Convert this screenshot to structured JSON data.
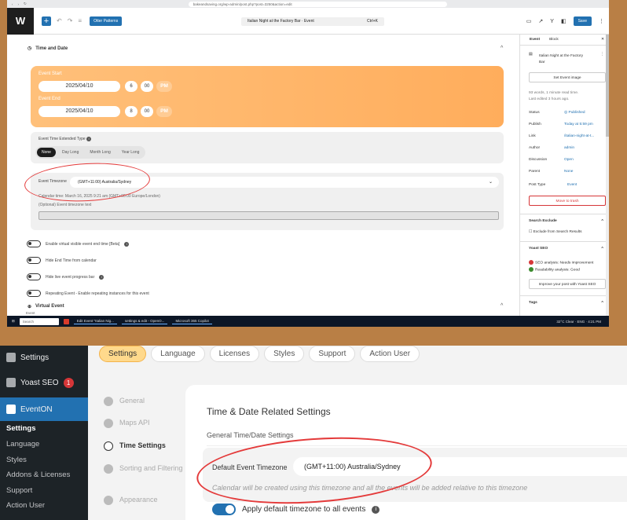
{
  "browser": {
    "url": "bakeandsaving.org/wp-admin/post.php?post=3250&action=edit"
  },
  "toolbar": {
    "otter_label": "Otter Patterns",
    "doc_title": "Italian Night at the Factory Bar · Event",
    "shortcut": "Ctrl+K",
    "save_label": "Save"
  },
  "event": {
    "section_title": "Time and Date",
    "start_label": "Event Start",
    "start_date": "2025/04/10",
    "start_hour": "6",
    "start_min": "00",
    "start_ampm": "PM",
    "end_label": "Event End",
    "end_date": "2025/04/10",
    "end_hour": "8",
    "end_min": "00",
    "end_ampm": "PM",
    "ext_label": "Event Time Extended Type",
    "ext_options": [
      "None",
      "Day Long",
      "Month Long",
      "Year Long"
    ],
    "tz_label": "Event Timezone",
    "tz_value": "(GMT+11:00) Australia/Sydney",
    "cal_time": "Calendar time: March 16, 2025 9:21 am (GMT+00:00 Europe/London)",
    "opt_tz_text": "(Optional) Event timezone text",
    "toggles": [
      "Enable virtual visible event end time [Beta]",
      "Hide End Time from calendar",
      "Hide live event progress bar",
      "Repeating Event - Enable repeating instances for this event"
    ],
    "virtual_title": "Virtual Event",
    "virtual_sub": "Event"
  },
  "sidebar": {
    "tab_event": "Event",
    "tab_block": "Block",
    "post_title": "Italian Night at the Factory Bar",
    "set_image": "Set Event image",
    "words": "93 words, 1 minute read time.",
    "edited": "Last edited 3 hours ago.",
    "rows": [
      {
        "k": "Status",
        "v": "Published"
      },
      {
        "k": "Publish",
        "v": "Today at 5:59 pm"
      },
      {
        "k": "Link",
        "v": "/italian-night-at-t..."
      },
      {
        "k": "Author",
        "v": "admin"
      },
      {
        "k": "Discussion",
        "v": "Open"
      },
      {
        "k": "Parent",
        "v": "None"
      },
      {
        "k": "Post Type",
        "v": "Event"
      }
    ],
    "trash": "Move to trash",
    "search_exclude": "Search Exclude",
    "exclude_label": "Exclude from Search Results",
    "yoast": "Yoast SEO",
    "seo": "SEO analysis: Needs improvement",
    "read": "Readability analysis: Good",
    "improve": "Improve your post with Yoast SEO",
    "tags": "Tags"
  },
  "taskbar": {
    "search": "Search",
    "app1": "Edit Event \"Italian Nig...",
    "app2": "settings & edit - OpenO...",
    "app3": "Microsoft 365 Copilot",
    "weather": "32°C Clear",
    "lang": "ENG",
    "time": "4:21 PM"
  },
  "admin": {
    "menu": [
      {
        "label": "Settings"
      },
      {
        "label": "Yoast SEO",
        "badge": "1"
      },
      {
        "label": "EventON"
      }
    ],
    "submenu": [
      "Settings",
      "Language",
      "Styles",
      "Addons & Licenses",
      "Support",
      "Action User"
    ]
  },
  "eventon": {
    "tabs": [
      "Settings",
      "Language",
      "Licenses",
      "Styles",
      "Support",
      "Action User"
    ],
    "nav": [
      "General",
      "Maps API",
      "Time Settings",
      "Sorting and Filtering",
      "Appearance"
    ],
    "heading": "Time & Date Related Settings",
    "subheading": "General Time/Date Settings",
    "tz_label": "Default Event Timezone",
    "tz_value": "(GMT+11:00) Australia/Sydney",
    "tz_help": "Calendar will be created using this timezone and all the events will be added relative to this timezone",
    "toggle_label": "Apply default timezone to all events"
  },
  "colors": {
    "accent": "#2271b1",
    "annotation": "#e43b3b",
    "orange": "#ffad5c"
  }
}
